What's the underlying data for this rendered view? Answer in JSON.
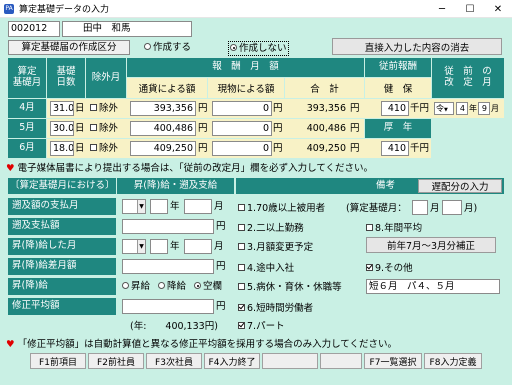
{
  "window": {
    "title": "算定基礎データの入力",
    "icon": "app-icon",
    "minimize": "─",
    "maximize": "☐",
    "close": "✕"
  },
  "header": {
    "emp_no": "002012",
    "emp_name": "田中　和馬",
    "section_label": "算定基礎届の作成区分",
    "radio_make": "作成する",
    "radio_nomake": "作成しない",
    "clear_button": "直接入力した内容の消去"
  },
  "grid": {
    "h_month": "算定\n基礎月",
    "h_days": "基礎\n日数",
    "h_excl": "除外月",
    "h_pay": "報　酬　月　額",
    "h_cash": "通貨による額",
    "h_kind": "現物による額",
    "h_total": "合　計",
    "h_prev": "従前報酬",
    "h_ins": "健　保",
    "h_prevrev": "従　前　の\n改　定　月",
    "rows": [
      {
        "month": "4月",
        "days": "31.0",
        "excl": "除外",
        "cash": "393,356",
        "kind": "0",
        "total": "393,356"
      },
      {
        "month": "5月",
        "days": "30.0",
        "excl": "除外",
        "cash": "400,486",
        "kind": "0",
        "total": "400,486"
      },
      {
        "month": "6月",
        "days": "18.0",
        "excl": "除外",
        "cash": "409,250",
        "kind": "0",
        "total": "409,250"
      }
    ],
    "prev_ins_1": "410",
    "prev_ins_2": "410",
    "pension_label": "厚　年",
    "unit_sen": "千円",
    "unit_en": "円",
    "unit_day": "日",
    "era": "令",
    "prev_year": "4",
    "prev_month": "9",
    "year_unit": "年",
    "month_unit": "月"
  },
  "notice1": "電子媒体届書により提出する場合は、「従前の改定月」欄を必ず入力してください。",
  "left": {
    "header_left": "〔算定基礎月における〕",
    "header_right": "昇(降)給・遡及支給",
    "labels": [
      "遡及額の支払月",
      "遡及支払額",
      "昇(降)給した月",
      "昇(降)給差月額",
      "昇(降)給",
      "修正平均額"
    ],
    "year": "年",
    "month": "月",
    "en": "円",
    "raise_options": [
      "昇給",
      "降給",
      "空欄"
    ],
    "avg_note": "(年:　　400,133円)"
  },
  "right": {
    "title": "備考",
    "late_button": "遅配分の入力",
    "items": [
      "1.70歳以上被用者",
      "2.二以上勤務",
      "3.月額変更予定",
      "4.途中入社",
      "5.病休・育休・休職等",
      "6.短時間労働者",
      "7.パート",
      "8.年間平均",
      "9.その他"
    ],
    "calc_label": "(算定基礎月：",
    "calc_month": "月",
    "calc_close": "月)",
    "adjust_button": "前年7月〜3月分補正",
    "other_text": "短６月　パ４、５月"
  },
  "notice2": "「修正平均額」は自動計算値と異なる修正平均額を採用する場合のみ入力してください。",
  "fkeys": [
    "F1前項目",
    "F2前社員",
    "F3次社員",
    "F4入力終了",
    "F7一覧選択",
    "F8入力定義"
  ],
  "colors": {
    "teal": "#1f8780",
    "mint": "#c9f0e4",
    "yellow": "#f8f2c6",
    "heart": "#e00000"
  }
}
